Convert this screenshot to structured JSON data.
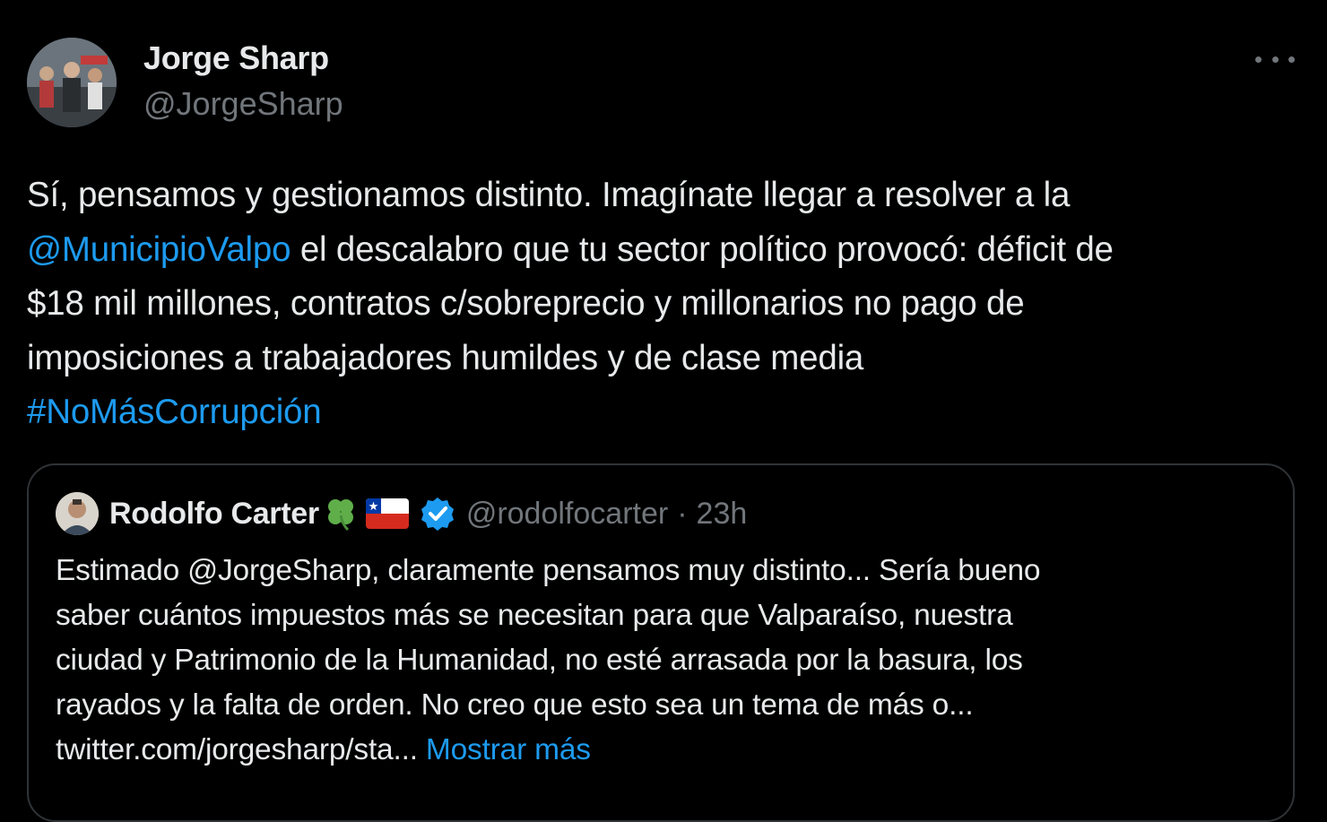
{
  "tweet": {
    "author_name": "Jorge Sharp",
    "author_handle": "@JorgeSharp",
    "more_icon": "more-horizontal-icon",
    "lines": [
      [
        {
          "text": "Sí, pensamos y gestionamos distinto. Imagínate llegar a resolver a la",
          "link": false
        }
      ],
      [
        {
          "text": "@MunicipioValpo",
          "link": true
        },
        {
          "text": " el descalabro que tu sector político provocó: déficit de",
          "link": false
        }
      ],
      [
        {
          "text": "$18 mil millones, contratos c/sobreprecio y millonarios no pago de",
          "link": false
        }
      ],
      [
        {
          "text": "imposiciones a trabajadores humildes y de clase media",
          "link": false
        }
      ],
      [
        {
          "text": "#NoMásCorrupción",
          "link": true
        }
      ]
    ]
  },
  "quote": {
    "author_name": "Rodolfo Carter",
    "name_emoji_icons": [
      "four-leaf-clover-icon",
      "chile-flag-icon"
    ],
    "verified_icon": "verified-badge-icon",
    "author_handle": "@rodolfocarter",
    "separator": "·",
    "time": "23h",
    "lines": [
      [
        {
          "text": "Estimado @JorgeSharp, claramente pensamos muy distinto... Sería bueno",
          "link": false
        }
      ],
      [
        {
          "text": "saber cuántos impuestos más se necesitan para que Valparaíso, nuestra",
          "link": false
        }
      ],
      [
        {
          "text": "ciudad y Patrimonio de la Humanidad, no esté arrasada por la basura, los",
          "link": false
        }
      ],
      [
        {
          "text": "rayados y la falta de orden. No creo que esto sea un tema de más o...",
          "link": false
        }
      ],
      [
        {
          "text": "twitter.com/jorgesharp/sta... ",
          "link": false
        },
        {
          "text": "Mostrar más",
          "link": true
        }
      ]
    ]
  },
  "colors": {
    "background": "#000000",
    "text": "#e7e9ea",
    "muted": "#71767b",
    "link": "#1d9bf0",
    "border": "#2f3336"
  }
}
